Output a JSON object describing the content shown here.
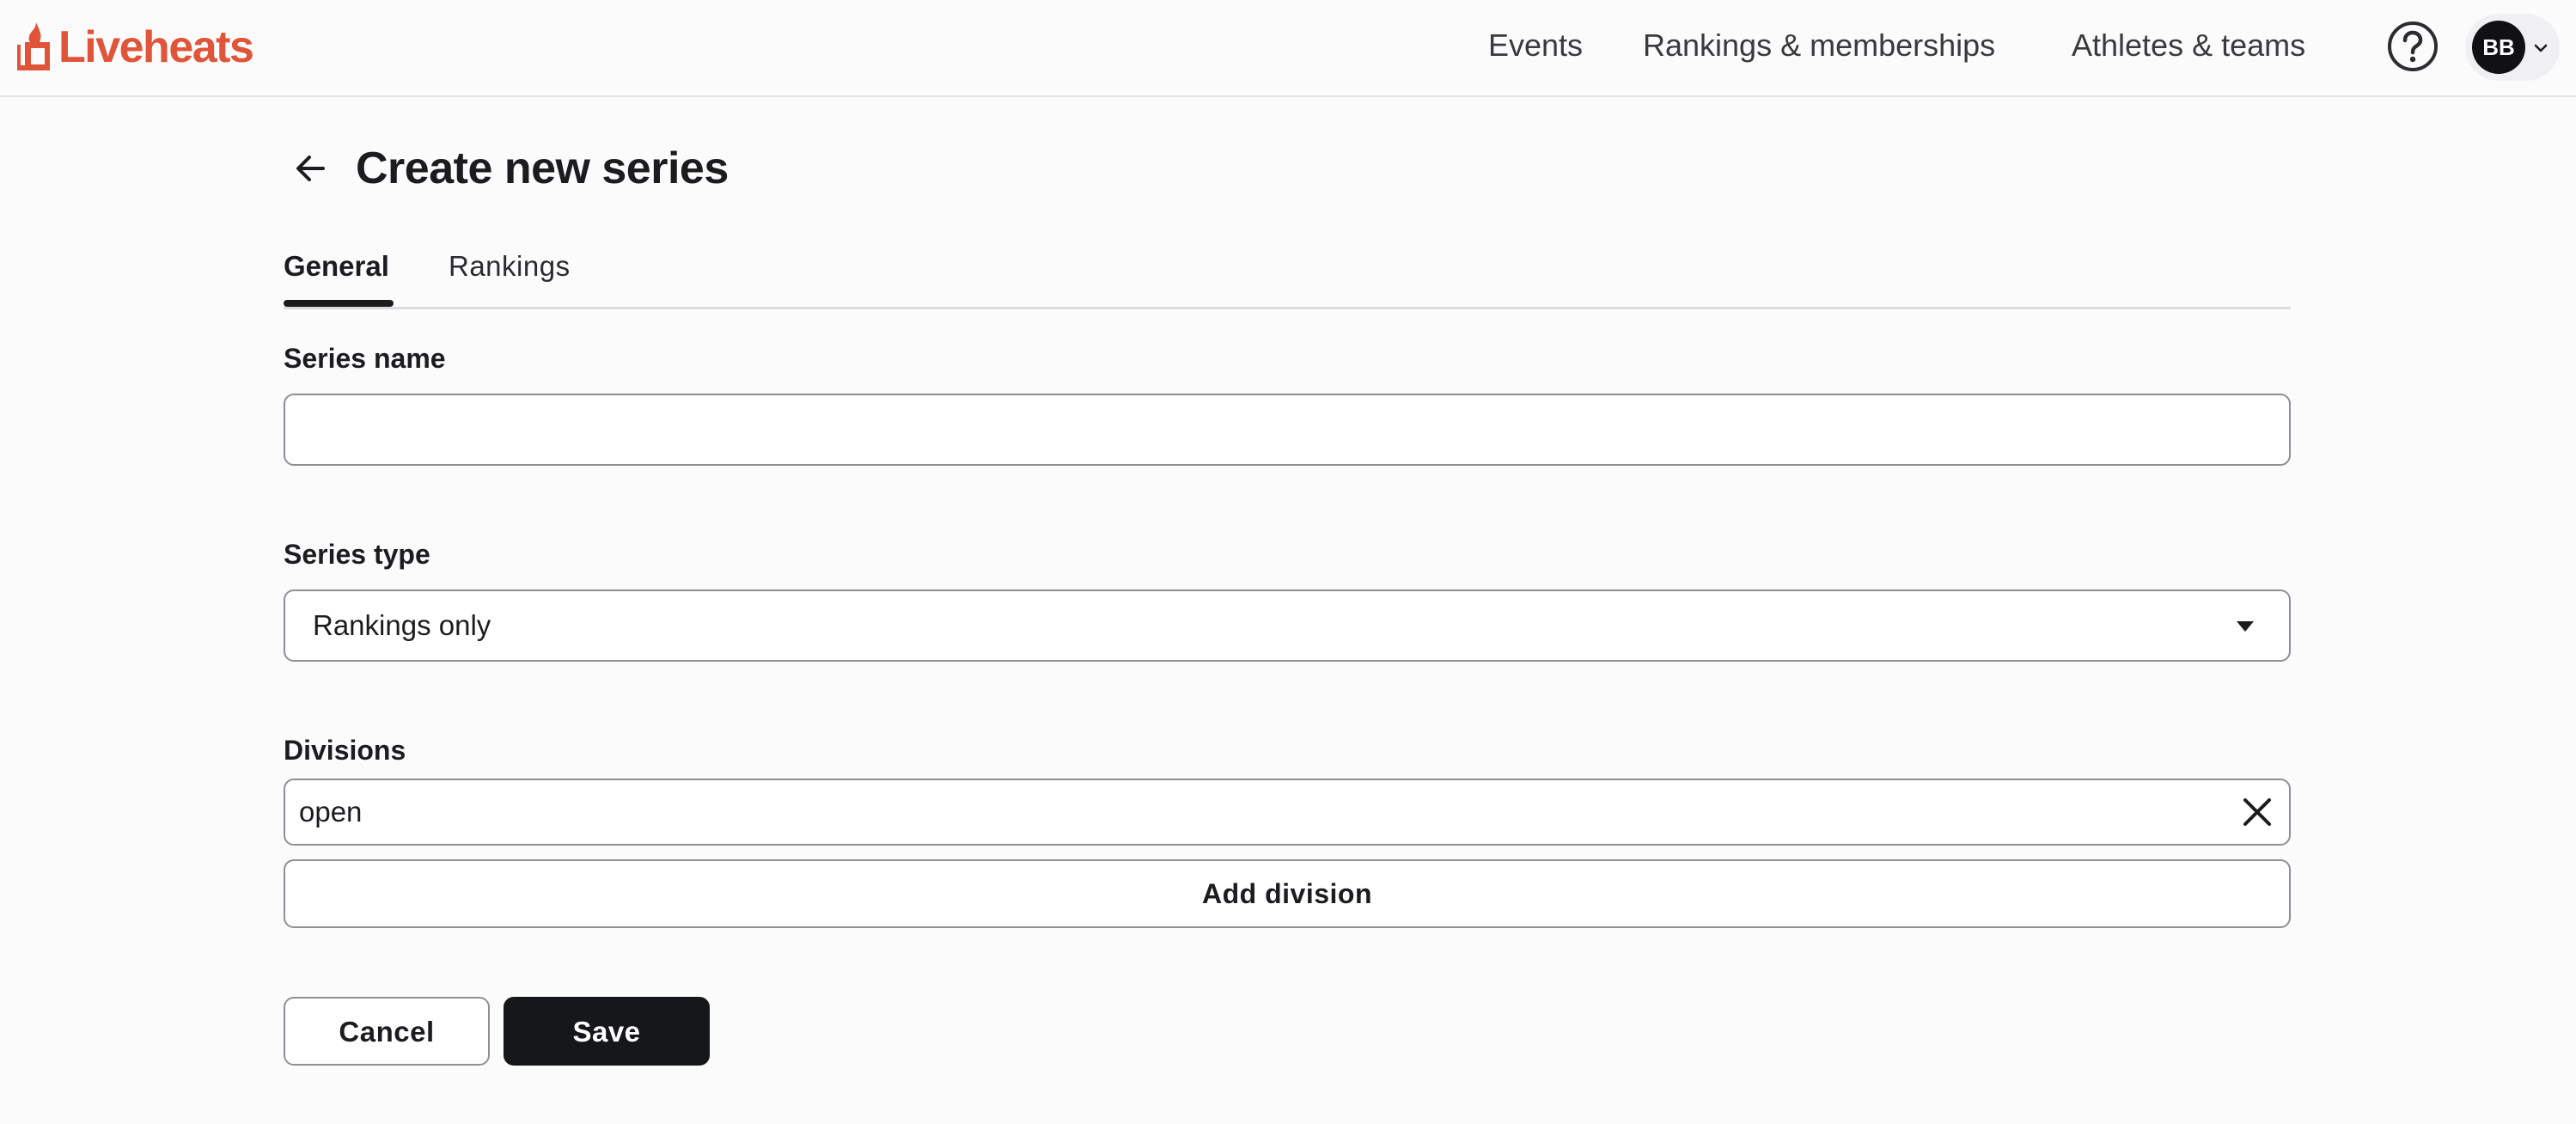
{
  "colors": {
    "brand": "#e0553a",
    "primary_button": "#16171a",
    "border": "#8f8f96",
    "background": "#fbfbfb"
  },
  "header": {
    "logo_text": "Liveheats",
    "logo_icon": "flame-logo-icon",
    "nav": [
      {
        "label": "Events"
      },
      {
        "label": "Rankings & memberships"
      },
      {
        "label": "Athletes & teams"
      }
    ],
    "help_icon": "help-circle-icon",
    "user": {
      "initials": "BB",
      "menu_icon": "chevron-down-icon"
    }
  },
  "page": {
    "back_icon": "arrow-left-icon",
    "title": "Create new series",
    "tabs": [
      {
        "label": "General",
        "active": true
      },
      {
        "label": "Rankings",
        "active": false
      }
    ]
  },
  "form": {
    "series_name": {
      "label": "Series name",
      "value": "",
      "placeholder": ""
    },
    "series_type": {
      "label": "Series type",
      "selected": "Rankings only",
      "icon": "caret-down-icon"
    },
    "divisions": {
      "label": "Divisions",
      "items": [
        {
          "value": "open",
          "remove_icon": "close-icon"
        }
      ],
      "add_label": "Add division"
    }
  },
  "actions": {
    "cancel_label": "Cancel",
    "save_label": "Save"
  }
}
